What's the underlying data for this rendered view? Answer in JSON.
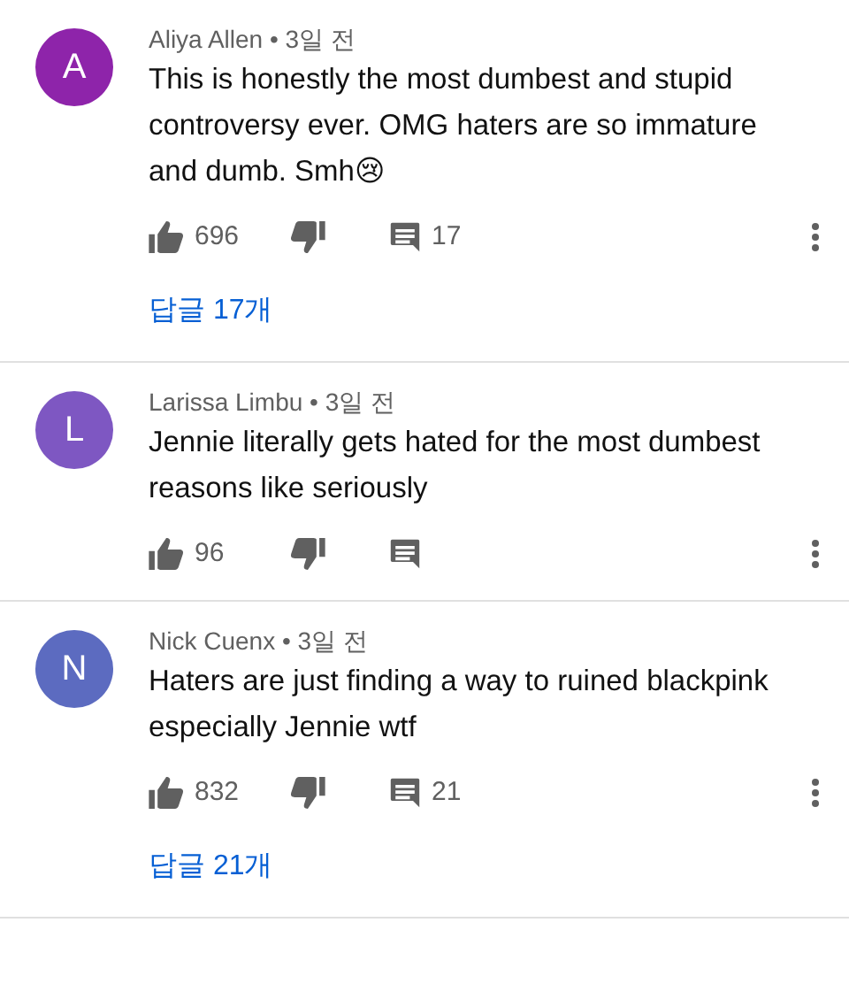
{
  "comments": [
    {
      "avatar": {
        "letter": "A",
        "color": "#8e24aa"
      },
      "byline": "Aliya Allen • 3일 전",
      "text": "This is honestly the most dumbest and stupid controversy ever. OMG haters are so immature and dumb. Smh😢",
      "likes": "696",
      "replies_count": "17",
      "replies_link": "답글 17개"
    },
    {
      "avatar": {
        "letter": "L",
        "color": "#7e57c2"
      },
      "byline": "Larissa Limbu • 3일 전",
      "text": "Jennie literally gets hated for the most dumbest reasons like seriously",
      "likes": "96"
    },
    {
      "avatar": {
        "letter": "N",
        "color": "#5c6bc0"
      },
      "byline": "Nick Cuenx • 3일 전",
      "text": "Haters are just finding a way to ruined blackpink especially Jennie wtf",
      "likes": "832",
      "replies_count": "21",
      "replies_link": "답글 21개"
    }
  ]
}
